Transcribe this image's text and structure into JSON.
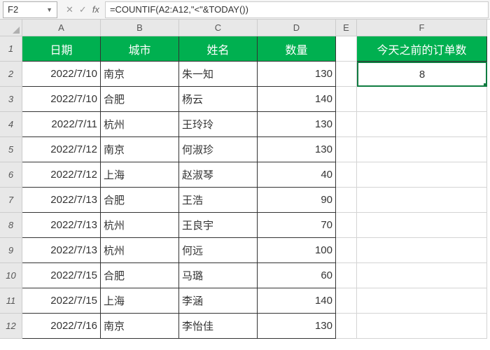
{
  "formulaBar": {
    "nameBox": "F2",
    "formula": "=COUNTIF(A2:A12,\"<\"&TODAY())"
  },
  "columns": [
    "A",
    "B",
    "C",
    "D",
    "E",
    "F"
  ],
  "rowNumbers": [
    "1",
    "2",
    "3",
    "4",
    "5",
    "6",
    "7",
    "8",
    "9",
    "10",
    "11",
    "12"
  ],
  "headers": {
    "a": "日期",
    "b": "城市",
    "c": "姓名",
    "d": "数量",
    "f": "今天之前的订单数"
  },
  "result": "8",
  "data": [
    {
      "date": "2022/7/10",
      "city": "南京",
      "name": "朱一知",
      "qty": "130"
    },
    {
      "date": "2022/7/10",
      "city": "合肥",
      "name": "杨云",
      "qty": "140"
    },
    {
      "date": "2022/7/11",
      "city": "杭州",
      "name": "王玲玲",
      "qty": "130"
    },
    {
      "date": "2022/7/12",
      "city": "南京",
      "name": "何淑珍",
      "qty": "130"
    },
    {
      "date": "2022/7/12",
      "city": "上海",
      "name": "赵淑琴",
      "qty": "40"
    },
    {
      "date": "2022/7/13",
      "city": "合肥",
      "name": "王浩",
      "qty": "90"
    },
    {
      "date": "2022/7/13",
      "city": "杭州",
      "name": "王良宇",
      "qty": "70"
    },
    {
      "date": "2022/7/13",
      "city": "杭州",
      "name": "何远",
      "qty": "100"
    },
    {
      "date": "2022/7/15",
      "city": "合肥",
      "name": "马璐",
      "qty": "60"
    },
    {
      "date": "2022/7/15",
      "city": "上海",
      "name": "李涵",
      "qty": "140"
    },
    {
      "date": "2022/7/16",
      "city": "南京",
      "name": "李怡佳",
      "qty": "130"
    }
  ],
  "chart_data": {
    "type": "table",
    "title": "COUNTIF Example - Orders Before Today",
    "columns": [
      "日期",
      "城市",
      "姓名",
      "数量"
    ],
    "rows": [
      [
        "2022/7/10",
        "南京",
        "朱一知",
        130
      ],
      [
        "2022/7/10",
        "合肥",
        "杨云",
        140
      ],
      [
        "2022/7/11",
        "杭州",
        "王玲玲",
        130
      ],
      [
        "2022/7/12",
        "南京",
        "何淑珍",
        130
      ],
      [
        "2022/7/12",
        "上海",
        "赵淑琴",
        40
      ],
      [
        "2022/7/13",
        "合肥",
        "王浩",
        90
      ],
      [
        "2022/7/13",
        "杭州",
        "王良宇",
        70
      ],
      [
        "2022/7/13",
        "杭州",
        "何远",
        100
      ],
      [
        "2022/7/15",
        "合肥",
        "马璐",
        60
      ],
      [
        "2022/7/15",
        "上海",
        "李涵",
        140
      ],
      [
        "2022/7/16",
        "南京",
        "李怡佳",
        130
      ]
    ],
    "summary": {
      "今天之前的订单数": 8
    }
  }
}
